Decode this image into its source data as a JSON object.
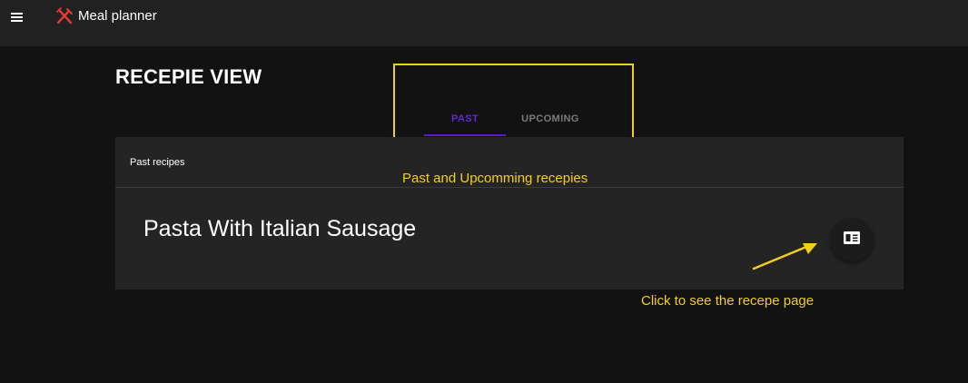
{
  "header": {
    "menu_icon": "hamburger-menu-icon",
    "logo_icon": "fork-knife-icon",
    "app_title": "Meal planner"
  },
  "page": {
    "title": "RECEPIE VIEW"
  },
  "tabs": [
    {
      "label": "PAST",
      "selected": true
    },
    {
      "label": "UPCOMING",
      "selected": false
    }
  ],
  "card": {
    "header_label": "Past recipes",
    "recipe_name": "Pasta With Italian Sausage",
    "action_icon": "recipe-card-icon"
  },
  "annotations": {
    "tabs_note": "Past and Upcomming recepies",
    "click_note": "Click to see the recepe page"
  },
  "colors": {
    "background": "#121212",
    "topbar": "#212121",
    "card": "#242424",
    "tab_active": "#5e17d6",
    "annotation": "#f2cf1d",
    "logo": "#e53935"
  }
}
